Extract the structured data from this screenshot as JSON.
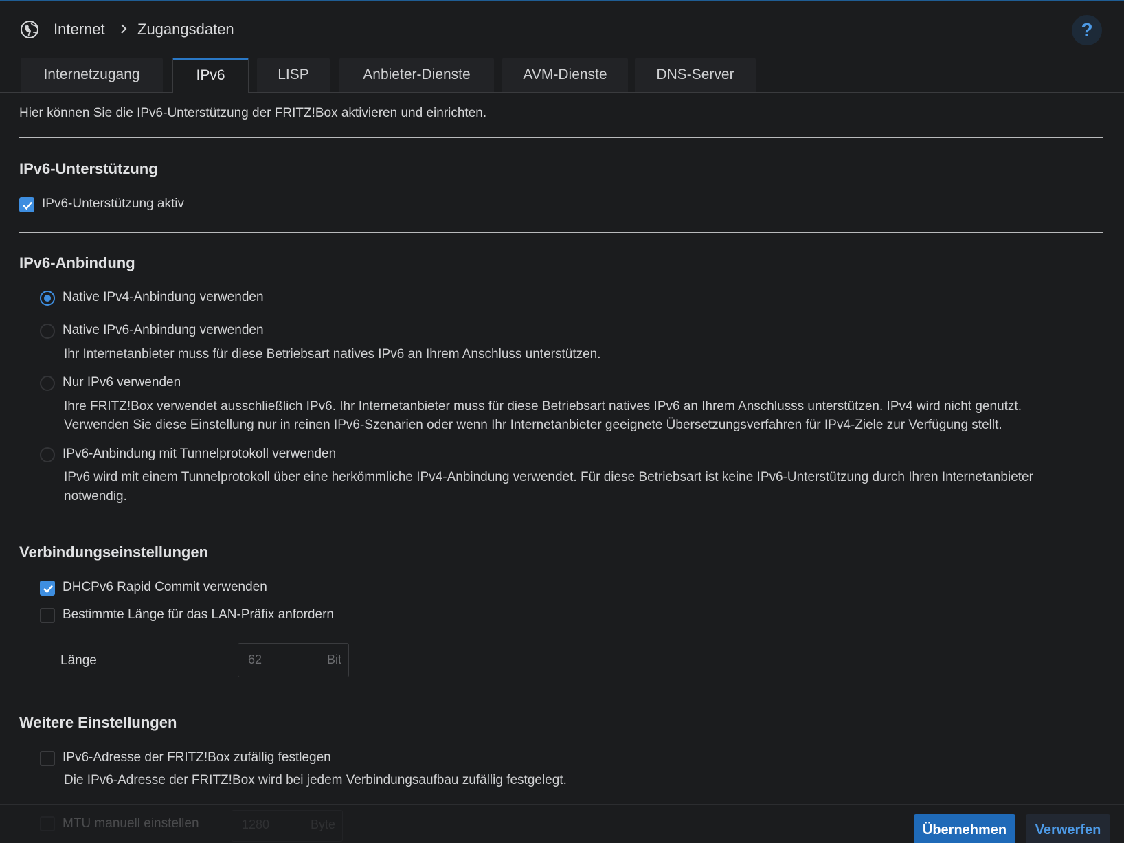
{
  "header": {
    "breadcrumb": [
      "Internet",
      "Zugangsdaten"
    ],
    "help_label": "?"
  },
  "tabs": [
    {
      "label": "Internetzugang",
      "active": false
    },
    {
      "label": "IPv6",
      "active": true
    },
    {
      "label": "LISP",
      "active": false
    },
    {
      "label": "Anbieter-Dienste",
      "active": false
    },
    {
      "label": "AVM-Dienste",
      "active": false
    },
    {
      "label": "DNS-Server",
      "active": false
    }
  ],
  "intro": "Hier können Sie die IPv6-Unterstützung der FRITZ!Box aktivieren und einrichten.",
  "support": {
    "heading": "IPv6-Unterstützung",
    "checkbox_label": "IPv6-Unterstützung aktiv",
    "checked": true
  },
  "binding": {
    "heading": "IPv6-Anbindung",
    "options": [
      {
        "label": "Native IPv4-Anbindung verwenden",
        "selected": true,
        "desc": []
      },
      {
        "label": "Native IPv6-Anbindung verwenden",
        "selected": false,
        "desc": [
          "Ihr Internetanbieter muss für diese Betriebsart natives IPv6 an Ihrem Anschluss unterstützen."
        ]
      },
      {
        "label": "Nur IPv6 verwenden",
        "selected": false,
        "desc": [
          "Ihre FRITZ!Box verwendet ausschließlich IPv6. Ihr Internetanbieter muss für diese Betriebsart natives IPv6 an Ihrem Anschlusss unterstützen. IPv4 wird nicht genutzt.",
          "Verwenden Sie diese Einstellung nur in reinen IPv6-Szenarien oder wenn Ihr Internetanbieter geeignete Übersetzungsverfahren für IPv4-Ziele zur Verfügung stellt."
        ]
      },
      {
        "label": "IPv6-Anbindung mit Tunnelprotokoll verwenden",
        "selected": false,
        "desc": [
          "IPv6 wird mit einem Tunnelprotokoll über eine herkömmliche IPv4-Anbindung verwendet. Für diese Betriebsart ist keine IPv6-Unterstützung durch Ihren Internetanbieter",
          "notwendig."
        ]
      }
    ]
  },
  "connection": {
    "heading": "Verbindungseinstellungen",
    "rapid_commit_label": "DHCPv6 Rapid Commit verwenden",
    "rapid_commit_checked": true,
    "prefix_label": "Bestimmte Länge für das LAN-Präfix anfordern",
    "prefix_checked": false,
    "length_label": "Länge",
    "length_value": "62",
    "length_unit": "Bit"
  },
  "more": {
    "heading": "Weitere Einstellungen",
    "random_label": "IPv6-Adresse der FRITZ!Box zufällig festlegen",
    "random_checked": false,
    "random_desc": "Die IPv6-Adresse der FRITZ!Box wird bei jedem Verbindungsaufbau zufällig festgelegt.",
    "mtu_label": "MTU manuell einstellen",
    "mtu_value": "1280",
    "mtu_unit": "Byte"
  },
  "footer": {
    "apply_label": "Übernehmen",
    "discard_label": "Verwerfen"
  },
  "colors": {
    "accent": "#3e8ee0",
    "primary_button": "#1f6ab8",
    "background": "#1b1c1e"
  }
}
